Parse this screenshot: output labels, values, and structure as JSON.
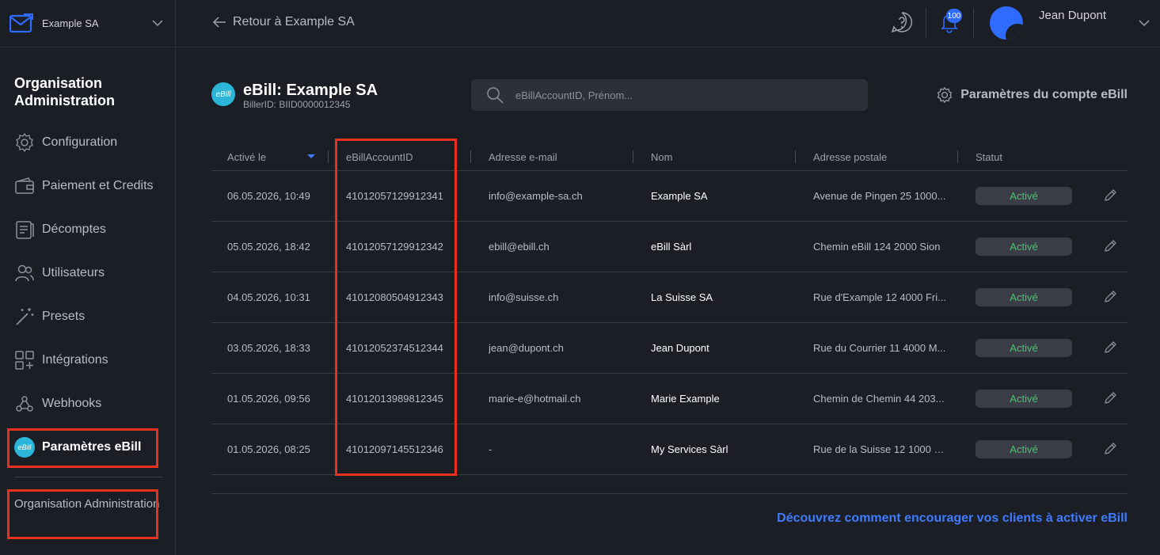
{
  "sidebar": {
    "org_name": "Example SA",
    "title": "Organisation Administration",
    "items": [
      {
        "label": "Configuration",
        "icon": "gear-icon"
      },
      {
        "label": "Paiement et Credits",
        "icon": "wallet-icon"
      },
      {
        "label": "Décomptes",
        "icon": "receipt-icon"
      },
      {
        "label": "Utilisateurs",
        "icon": "users-icon"
      },
      {
        "label": "Presets",
        "icon": "magic-wand-icon"
      },
      {
        "label": "Intégrations",
        "icon": "grid-plus-icon"
      },
      {
        "label": "Webhooks",
        "icon": "webhook-icon"
      },
      {
        "label": "Paramètres eBill",
        "icon": "ebill-logo-icon",
        "badge": "eBill"
      }
    ],
    "footer": "Organisation Administration"
  },
  "topbar": {
    "back_label": "Retour à Example SA",
    "notification_count": "100",
    "user_name": "Jean Dupont"
  },
  "main": {
    "logo_text": "eBill",
    "title": "eBill: Example SA",
    "biller_id": "BillerID: BIID0000012345",
    "search_placeholder": "eBillAccountID, Prénom...",
    "settings_label": "Paramètres du compte eBill",
    "columns": [
      "Activé le",
      "eBillAccountID",
      "Adresse e-mail",
      "Nom",
      "Adresse postale",
      "Statut"
    ],
    "rows": [
      {
        "date": "06.05.2026, 10:49",
        "account_id": "41012057129912341",
        "email": "info@example-sa.ch",
        "name": "Example SA",
        "address": "Avenue de Pingen 25 1000...",
        "status": "Activé"
      },
      {
        "date": "05.05.2026, 18:42",
        "account_id": "41012057129912342",
        "email": "ebill@ebill.ch",
        "name": "eBill Sàrl",
        "address": "Chemin eBill 124 2000 Sion",
        "status": "Activé"
      },
      {
        "date": "04.05.2026, 10:31",
        "account_id": "41012080504912343",
        "email": "info@suisse.ch",
        "name": "La Suisse SA",
        "address": "Rue d'Example 12 4000 Fri...",
        "status": "Activé"
      },
      {
        "date": "03.05.2026, 18:33",
        "account_id": "41012052374512344",
        "email": "jean@dupont.ch",
        "name": "Jean Dupont",
        "address": "Rue du Courrier 11 4000 M...",
        "status": "Activé"
      },
      {
        "date": "01.05.2026, 09:56",
        "account_id": "41012013989812345",
        "email": "marie-e@hotmail.ch",
        "name": "Marie Example",
        "address": "Chemin de Chemin 44 203...",
        "status": "Activé"
      },
      {
        "date": "01.05.2026, 08:25",
        "account_id": "41012097145512346",
        "email": "-",
        "name": "My Services Sàrl",
        "address": "Rue de la Suisse 12 1000 B...",
        "status": "Activé"
      }
    ],
    "footer_link": "Découvrez comment encourager vos clients à activer eBill"
  },
  "colors": {
    "background": "#1c1e26",
    "accent": "#3f7bff",
    "ebill": "#2bb5d9",
    "status_active": "#4ec46b",
    "highlight": "#e8321f"
  }
}
